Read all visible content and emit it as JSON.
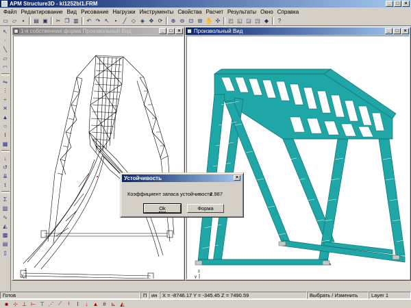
{
  "app": {
    "title": "APM Structure3D - kl1252bl1.FRM",
    "window_controls": [
      "_",
      "□",
      "×"
    ]
  },
  "menu": [
    "Файл",
    "Редактирование",
    "Вид",
    "Рисование",
    "Нагрузки",
    "Инструменты",
    "Свойства",
    "Расчет",
    "Результаты",
    "Окно",
    "Справка"
  ],
  "toolbar": {
    "icons": [
      "new-icon",
      "open-icon",
      "save-icon",
      "print-icon",
      "preview-icon",
      "cut-icon",
      "copy-icon",
      "paste-icon",
      "undo-icon",
      "redo-icon",
      "select-icon",
      "node-icon",
      "beam-icon",
      "plate-icon",
      "solid-icon",
      "move-icon",
      "rotate-icon",
      "zoom-in-icon",
      "zoom-out-icon",
      "zoom-window-icon",
      "zoom-all-icon",
      "pan-icon",
      "orbit-icon",
      "view-front-icon",
      "view-side-icon",
      "view-top-icon",
      "view-iso-icon",
      "render-icon",
      "help-icon"
    ]
  },
  "left_toolbar": {
    "icons": [
      "pointer-icon",
      "node-add-icon",
      "beam-add-icon",
      "plate-add-icon",
      "arc-icon",
      "copy-mirror-icon",
      "array-icon",
      "divide-icon",
      "intersect-icon",
      "support-icon",
      "hinge-icon",
      "section-icon",
      "material-icon",
      "load-force-icon",
      "load-moment-icon",
      "load-dist-icon",
      "temperature-icon",
      "calc-icon",
      "results-icon",
      "deform-icon",
      "diagram-icon",
      "stress-icon",
      "table-icon",
      "report-icon"
    ]
  },
  "windows": {
    "left": {
      "title": "1-я собственная форма Произвольный Вид",
      "controls": [
        "_",
        "□",
        "×"
      ],
      "axis": {
        "z": "z",
        "y": "y",
        "x": "x"
      }
    },
    "right": {
      "title": "Произвольный Вид",
      "controls": [
        "_",
        "□",
        "×"
      ],
      "axis": {
        "z": "z",
        "y": "y",
        "x": "x"
      },
      "structure_color": "#1fa6a6"
    }
  },
  "dialog": {
    "title": "Устойчивость",
    "label": "Коэффициент запаса устойчивости",
    "value": "2.987",
    "ok_label": "Ok",
    "form_label": "Форма",
    "close": "×"
  },
  "status": {
    "ready": "Готов",
    "p": "П",
    "in": "ин",
    "coords": "X = -8746.17 Y = -345.45 Z = 7490.59",
    "mode": "Выбрать / Изменить",
    "layer": "Layer 1"
  },
  "bottom_toolbar": {
    "icons": [
      "stop-icon",
      "node-snap-icon",
      "axis-x-icon",
      "axis-y-icon",
      "axis-z-icon",
      "grid-icon",
      "snap-icon",
      "ortho-icon",
      "section-view-icon",
      "load-view-icon",
      "support-view-icon",
      "number-view-icon",
      "local-axis-icon",
      "perspective-icon"
    ]
  }
}
